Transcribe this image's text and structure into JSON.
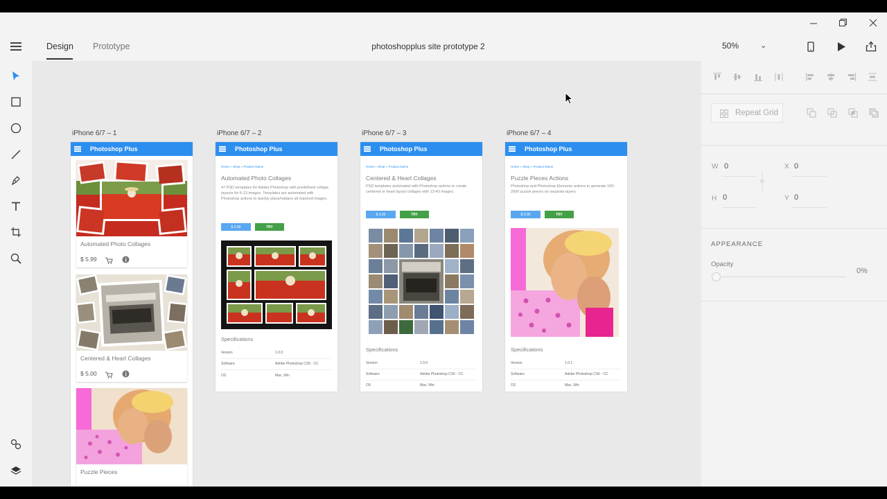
{
  "window": {
    "minimize_icon": "minimize-icon",
    "restore_icon": "restore-icon",
    "close_icon": "close-icon"
  },
  "topbar": {
    "tabs": [
      {
        "label": "Design",
        "active": true
      },
      {
        "label": "Prototype",
        "active": false
      }
    ],
    "document_title": "photoshopplus site prototype 2",
    "zoom": "50%"
  },
  "left_tools": [
    "select-tool",
    "rectangle-tool",
    "ellipse-tool",
    "line-tool",
    "pen-tool",
    "text-tool",
    "artboard-tool",
    "zoom-tool",
    "symbols-tool",
    "layers-tool"
  ],
  "artboards": [
    {
      "label": "iPhone 6/7 – 1",
      "header": "Photoshop Plus",
      "cards": [
        {
          "name": "Automated Photo Collages",
          "price": "$ 5.99"
        },
        {
          "name": "Centered & Heart Collages",
          "price": "$ 5.00"
        },
        {
          "name": "Puzzle Pieces",
          "price": ""
        }
      ]
    },
    {
      "label": "iPhone 6/7 – 2",
      "header": "Photoshop Plus",
      "breadcrumb": "Home » Shop » Product Name",
      "title": "Automated Photo Collages",
      "description": "47 PSD templates for Adobe Photoshop with predefined collage layouts for 6-13 images. Templates are automated with Photoshop actions to quickly place/replace all required images.",
      "price": "$ 5.99",
      "try": "TRY",
      "specs_title": "Specifications",
      "specs": [
        {
          "key": "Version",
          "value": "1.0.0"
        },
        {
          "key": "Software",
          "value": "Adobe Photoshop CS6 - CC"
        },
        {
          "key": "OS",
          "value": "Mac, Win"
        }
      ]
    },
    {
      "label": "iPhone 6/7 – 3",
      "header": "Photoshop Plus",
      "breadcrumb": "Home » Shop » Product Name",
      "title": "Centered & Heart Collages",
      "description": "PSD templates automated with Photoshop actions to create centered or heart layout collages with 13-43 images.",
      "price": "$ 5.00",
      "try": "TRY",
      "specs_title": "Specifications",
      "specs": [
        {
          "key": "Version",
          "value": "1.0.0"
        },
        {
          "key": "Software",
          "value": "Adobe Photoshop CS6 - CC"
        },
        {
          "key": "OS",
          "value": "Mac, Win"
        }
      ]
    },
    {
      "label": "iPhone 6/7 – 4",
      "header": "Photoshop Plus",
      "breadcrumb": "Home » Shop » Product Name",
      "title": "Puzzle Pieces Actions",
      "description": "Photoshop and Photoshop Elements actions to generate 100-2000 puzzle pieces on separate layers.",
      "price": "$ 5.00",
      "try": "TRY",
      "specs_title": "Specifications",
      "specs": [
        {
          "key": "Version",
          "value": "1.0.1"
        },
        {
          "key": "Software",
          "value": "Adobe Photoshop CS6 - CC"
        },
        {
          "key": "OS",
          "value": "Mac, Win"
        }
      ]
    }
  ],
  "properties": {
    "repeat_grid": "Repeat Grid",
    "w_label": "W",
    "w_value": "0",
    "x_label": "X",
    "x_value": "0",
    "h_label": "H",
    "h_value": "0",
    "y_label": "Y",
    "y_value": "0",
    "appearance": "APPEARANCE",
    "opacity_label": "Opacity",
    "opacity_value": "0%"
  },
  "colors": {
    "accent": "#2c8ff0",
    "try_green": "#43a047",
    "canvas": "#e9e9e9",
    "panel": "#f3f3f3"
  }
}
